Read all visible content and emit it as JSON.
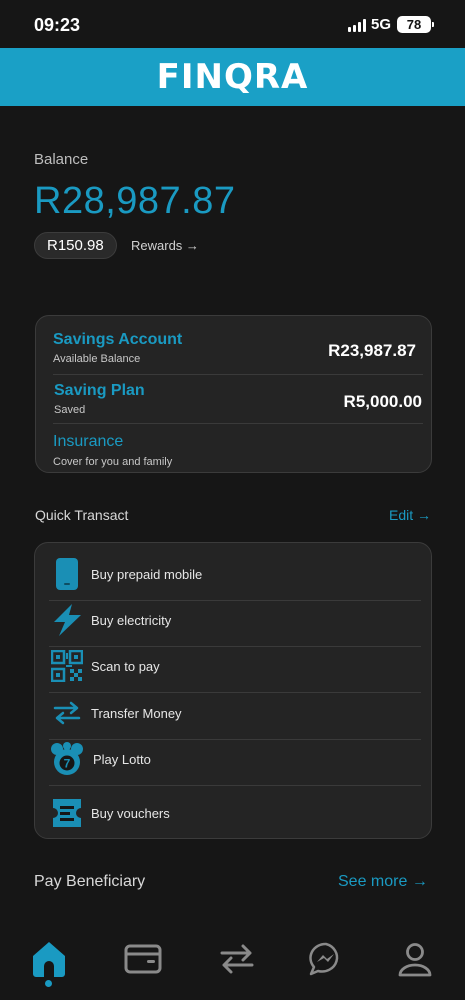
{
  "status_bar": {
    "time": "09:23",
    "network": "5G",
    "battery": "78"
  },
  "brand": {
    "logo_text": "FINQRA"
  },
  "balance": {
    "label": "Balance",
    "amount": "R28,987.87",
    "rewards_points": "R150.98",
    "rewards_link": "Rewards →"
  },
  "accounts": [
    {
      "title": "Savings Account",
      "subtitle": "Available Balance",
      "amount": "R23,987.87"
    },
    {
      "title": "Saving Plan",
      "subtitle": "Saved",
      "amount": "R5,000.00"
    },
    {
      "title": "Insurance",
      "subtitle": "Cover for you and family",
      "amount": ""
    }
  ],
  "quick_transact": {
    "title": "Quick Transact",
    "edit_label": "Edit →",
    "items": [
      {
        "label": "Buy prepaid mobile",
        "icon": "mobile-phone-icon"
      },
      {
        "label": "Buy electricity",
        "icon": "lightning-icon"
      },
      {
        "label": "Scan to pay",
        "icon": "qr-code-icon"
      },
      {
        "label": "Transfer Money",
        "icon": "transfer-arrows-icon"
      },
      {
        "label": "Play Lotto",
        "icon": "lotto-ball-icon"
      },
      {
        "label": "Buy vouchers",
        "icon": "voucher-icon"
      }
    ]
  },
  "pay_beneficiary": {
    "title": "Pay Beneficiary",
    "see_more_label": "See more →"
  },
  "bottom_nav": {
    "items": [
      {
        "icon": "home-icon",
        "active": true
      },
      {
        "icon": "wallet-icon",
        "active": false
      },
      {
        "icon": "transfer-icon",
        "active": false
      },
      {
        "icon": "messenger-icon",
        "active": false
      },
      {
        "icon": "profile-icon",
        "active": false
      }
    ]
  },
  "colors": {
    "accent": "#1a9ac2",
    "brand_bar": "#1aa0c6",
    "background": "#161616",
    "card": "#242424"
  }
}
